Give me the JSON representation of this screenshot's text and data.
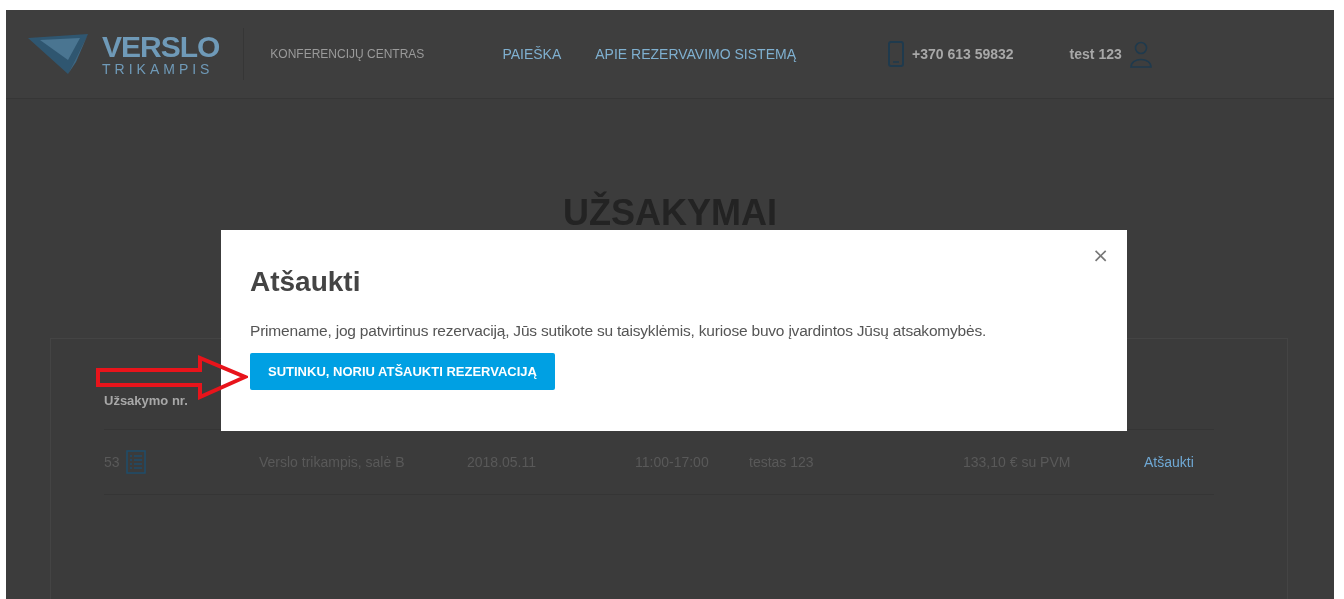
{
  "header": {
    "logo": {
      "word": "VERSLO",
      "sub": "TRIKAMPIS"
    },
    "tagline": "KONFERENCIJŲ CENTRAS",
    "nav": [
      "PAIEŠKA",
      "APIE REZERVAVIMO SISTEMĄ"
    ],
    "phone": "+370 613 59832",
    "user": "test 123"
  },
  "page_title": "UŽSAKYMAI",
  "table": {
    "columns": [
      "Užsakymo nr."
    ],
    "rows": [
      {
        "number": "53",
        "venue": "Verslo trikampis, salė B",
        "date": "2018.05.11",
        "time": "11:00-17:00",
        "customer": "testas 123",
        "price": "133,10 € su PVM",
        "action": "Atšaukti"
      }
    ]
  },
  "modal": {
    "title": "Atšaukti",
    "close": "×",
    "message": "Primename, jog patvirtinus rezervaciją, Jūs sutikote su taisyklėmis, kuriose buvo įvardintos Jūsų atsakomybės.",
    "confirm_button": "SUTINKU, NORIU ATŠAUKTI REZERVACIJĄ"
  }
}
